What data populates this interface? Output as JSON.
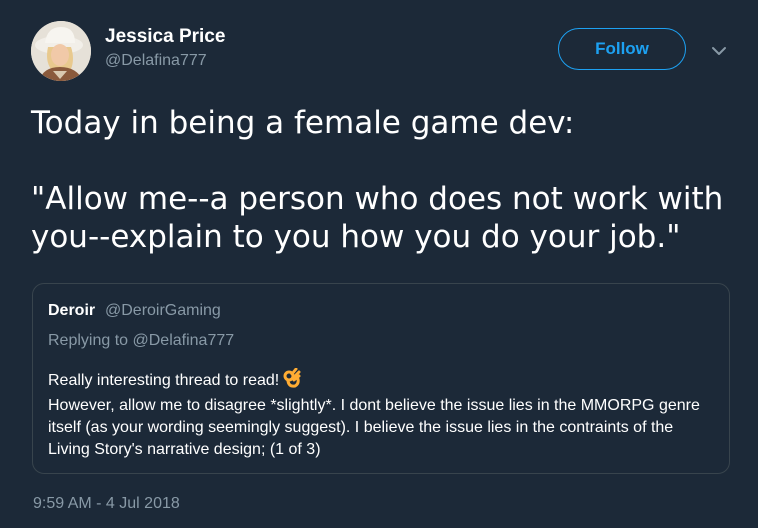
{
  "author": {
    "name": "Jessica Price",
    "handle": "@Delafina777",
    "avatar_icon": "portrait-avatar"
  },
  "follow_button": {
    "label": "Follow",
    "color": "#1da1f2"
  },
  "menu": {
    "icon": "chevron-down-icon"
  },
  "tweet": {
    "text": "Today in being a female game dev:\n\n\"Allow me--a person who does not work with you--explain to you how you do your job.\""
  },
  "quoted_tweet": {
    "name": "Deroir",
    "handle": "@DeroirGaming",
    "replying_to": "Replying to @Delafina777",
    "line1": "Really interesting thread to read!",
    "emoji_icon": "ok-hand-icon",
    "body": "However, allow me to disagree *slightly*. I dont believe the issue lies in the MMORPG genre itself (as your wording seemingly suggest). I believe the issue lies in the contraints of the Living Story's narrative design; (1 of 3)"
  },
  "timestamp": "9:59 AM - 4 Jul 2018",
  "colors": {
    "background": "#1c2938",
    "muted_text": "#8899a6",
    "border": "#38444d"
  }
}
